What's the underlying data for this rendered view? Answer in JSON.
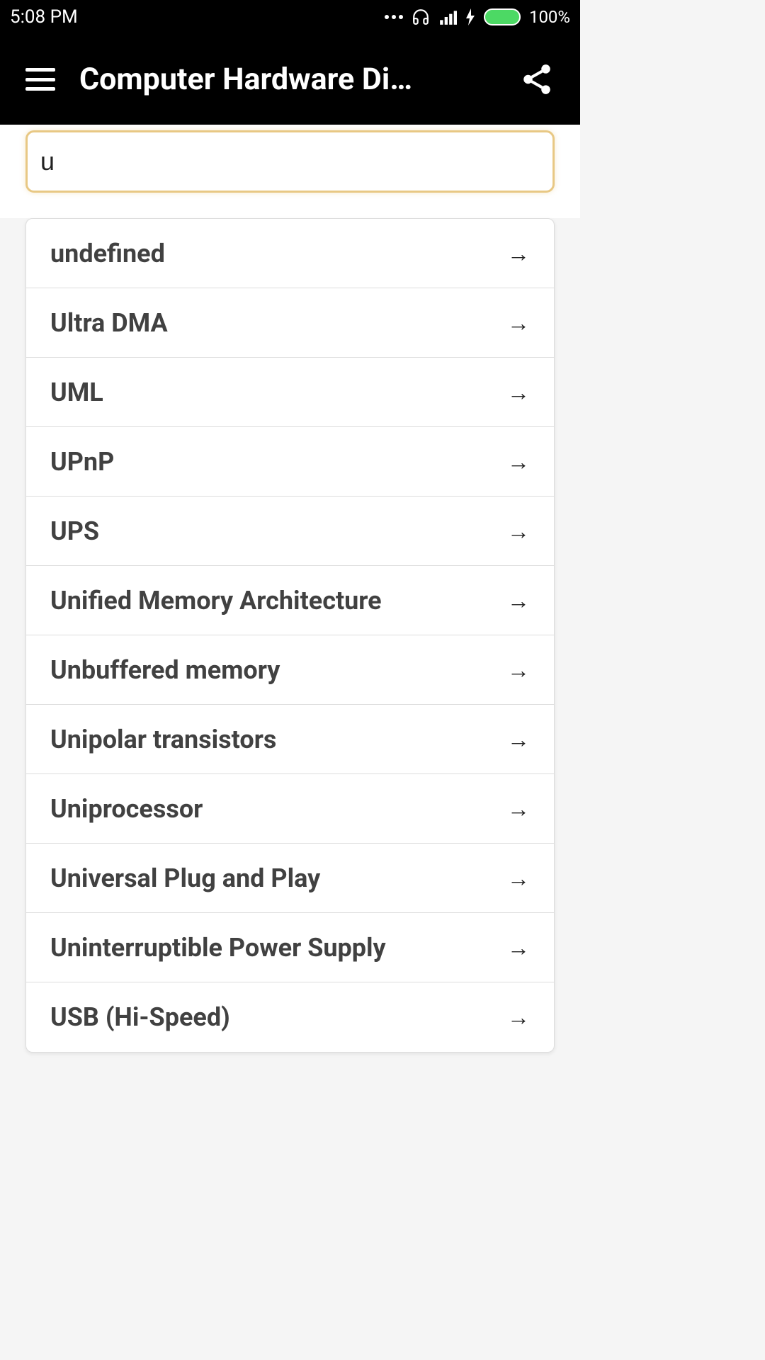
{
  "status_bar": {
    "time": "5:08 PM",
    "battery_percent": "100%"
  },
  "app_bar": {
    "title": "Computer Hardware Di…"
  },
  "search": {
    "value": "u"
  },
  "list_items": [
    {
      "label": "undefined"
    },
    {
      "label": "Ultra DMA"
    },
    {
      "label": "UML"
    },
    {
      "label": "UPnP"
    },
    {
      "label": "UPS"
    },
    {
      "label": "Unified Memory Architecture"
    },
    {
      "label": "Unbuffered memory"
    },
    {
      "label": "Unipolar transistors"
    },
    {
      "label": "Uniprocessor"
    },
    {
      "label": "Universal Plug and Play"
    },
    {
      "label": "Uninterruptible Power Supply"
    },
    {
      "label": "USB (Hi-Speed)"
    }
  ]
}
